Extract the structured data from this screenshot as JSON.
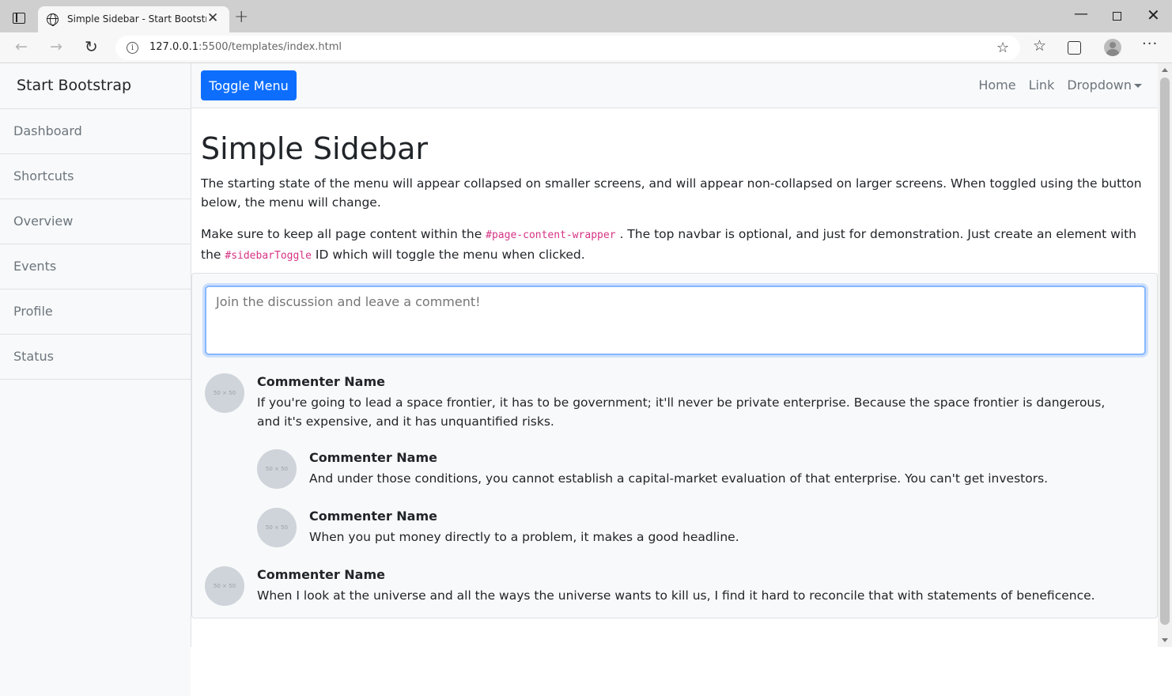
{
  "browser": {
    "tab_title": "Simple Sidebar - Start Bootstrap",
    "tab_close": "✕",
    "new_tab": "+",
    "url_host": "127.0.0.1",
    "url_rest": ":5500/templates/index.html"
  },
  "sidebar": {
    "brand": "Start Bootstrap",
    "items": [
      {
        "label": "Dashboard"
      },
      {
        "label": "Shortcuts"
      },
      {
        "label": "Overview"
      },
      {
        "label": "Events"
      },
      {
        "label": "Profile"
      },
      {
        "label": "Status"
      }
    ]
  },
  "topnav": {
    "toggle_label": "Toggle Menu",
    "links": [
      "Home",
      "Link",
      "Dropdown"
    ]
  },
  "main": {
    "title": "Simple Sidebar",
    "para1": "The starting state of the menu will appear collapsed on smaller screens, and will appear non-collapsed on larger screens. When toggled using the button below, the menu will change.",
    "para2_a": "Make sure to keep all page content within the ",
    "para2_code1": "#page-content-wrapper",
    "para2_b": " . The top navbar is optional, and just for demonstration. Just create an element with the ",
    "para2_code2": "#sidebarToggle",
    "para2_c": " ID which will toggle the menu when clicked."
  },
  "comments": {
    "placeholder": "Join the discussion and leave a comment!",
    "avatar_text": "50 × 50",
    "list": [
      {
        "name": "Commenter Name",
        "text": "If you're going to lead a space frontier, it has to be government; it'll never be private enterprise. Because the space frontier is dangerous, and it's expensive, and it has unquantified risks."
      },
      {
        "name": "Commenter Name",
        "text": "And under those conditions, you cannot establish a capital-market evaluation of that enterprise. You can't get investors."
      },
      {
        "name": "Commenter Name",
        "text": "When you put money directly to a problem, it makes a good headline."
      },
      {
        "name": "Commenter Name",
        "text": "When I look at the universe and all the ways the universe wants to kill us, I find it hard to reconcile that with statements of beneficence."
      }
    ]
  },
  "colors": {
    "primary": "#0d6efd",
    "code": "#d63384",
    "muted": "#6c757d"
  }
}
